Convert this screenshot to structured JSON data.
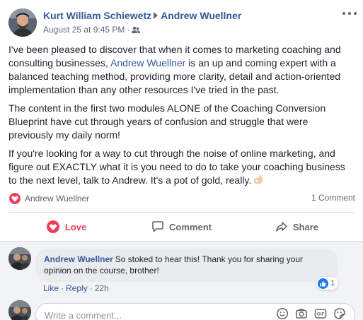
{
  "header": {
    "author": "Kurt William Schiewetz",
    "recipient": "Andrew Wuellner",
    "timestamp": "August 25 at 9:45 PM",
    "dot": "·",
    "privacy_icon": "friends-icon"
  },
  "post": {
    "p1_before": "I've been pleased to discover that when it comes to marketing coaching and consulting businesses, ",
    "p1_mention": "Andrew Wuellner",
    "p1_after": " is an up and coming expert with a balanced teaching method, providing more clarity, detail and action-oriented implementation than any other resources I've tried in the past.",
    "p2": "The content in the first two modules ALONE of the Coaching Conversion Blueprint have cut through years of confusion and struggle that were previously my daily norm!",
    "p3": "If you're looking for a way to cut through the noise of online marketing, and figure out EXACTLY what it is you need to do to take your coaching business to the next level, talk to Andrew. It's a pot of gold, really.",
    "p3_emoji": "ok-hand-emoji"
  },
  "reactions": {
    "reactor": "Andrew Wuellner",
    "comment_count": "1 Comment",
    "love_color": "#f33e58"
  },
  "actions": {
    "love": "Love",
    "comment": "Comment",
    "share": "Share"
  },
  "comment": {
    "author": "Andrew Wuellner",
    "text": "So stoked to hear this! Thank you for sharing your opinion on the course, brother!",
    "likes": "1",
    "like_label": "Like",
    "reply_label": "Reply",
    "sep": "·",
    "time": "22h"
  },
  "composer": {
    "placeholder": "Write a comment...",
    "icons": [
      "emoji-icon",
      "camera-icon",
      "gif-icon",
      "sticker-icon"
    ]
  },
  "colors": {
    "link": "#385898",
    "meta": "#616770",
    "like_blue": "#1877f2"
  }
}
